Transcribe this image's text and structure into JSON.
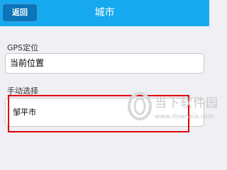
{
  "header": {
    "back_label": "返回",
    "title": "城市"
  },
  "gps": {
    "label": "GPS定位",
    "value": "当前位置"
  },
  "manual": {
    "label": "手动选择",
    "value": "邹平市"
  },
  "watermark": {
    "title": "当下软件园",
    "url": "www.downxia.com"
  },
  "colors": {
    "header": "#17a9ef",
    "back_button": "#0c74b8",
    "highlight": "#e00000",
    "background": "#efeff4"
  }
}
